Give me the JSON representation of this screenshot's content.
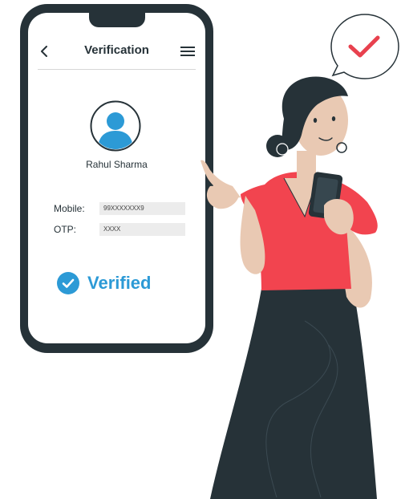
{
  "screen": {
    "title": "Verification",
    "back_icon": "chevron-left-icon",
    "menu_icon": "hamburger-menu-icon"
  },
  "profile": {
    "name": "Rahul Sharma",
    "avatar_icon": "user-avatar-icon"
  },
  "form": {
    "mobile_label": "Mobile:",
    "mobile_value": "99XXXXXXX9",
    "otp_label": "OTP:",
    "otp_value": "XXXX"
  },
  "status": {
    "text": "Verified",
    "icon": "check-circle-icon",
    "color": "#2c9ad6"
  },
  "illustration": {
    "bubble_icon": "checkmark-speech-bubble-icon",
    "check_color": "#e8414e",
    "shirt_color": "#f2444f",
    "skirt_color": "#263238"
  }
}
